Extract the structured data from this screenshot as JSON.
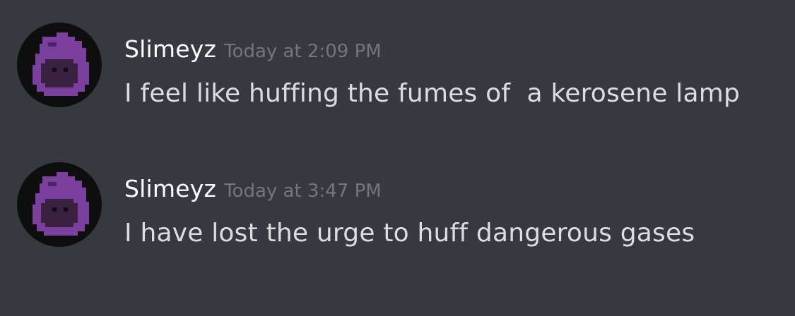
{
  "colors": {
    "background": "#36393f",
    "username": "#ffffff",
    "timestamp": "#72767d",
    "message_text": "#dcddde",
    "avatar_bg": "#0e0e0e",
    "avatar_slime": "#7b3f9e",
    "avatar_slime_dark": "#4a2466",
    "avatar_face": "#3a2140"
  },
  "messages": [
    {
      "avatar_icon": "purple-slime-avatar-icon",
      "username": "Slimeyz",
      "timestamp": "Today at 2:09 PM",
      "text": "I feel like huffing the fumes of  a kerosene lamp"
    },
    {
      "avatar_icon": "purple-slime-avatar-icon",
      "username": "Slimeyz",
      "timestamp": "Today at 3:47 PM",
      "text": "I have lost the urge to huff dangerous gases"
    }
  ]
}
